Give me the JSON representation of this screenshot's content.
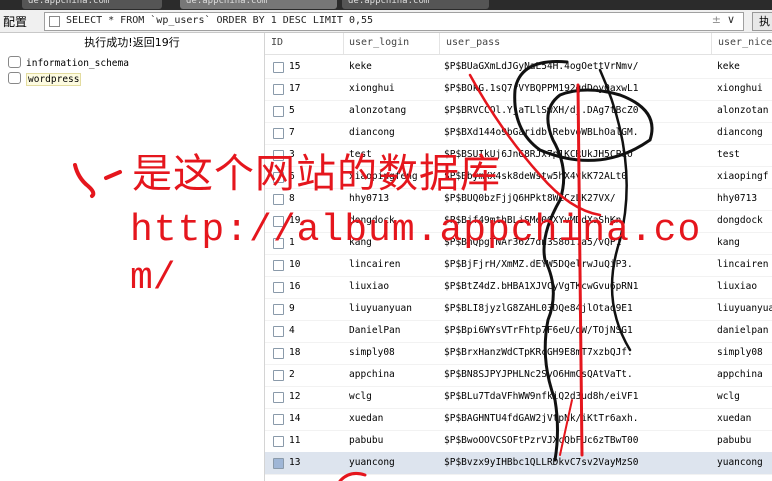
{
  "browser_tabs": [
    "de.appchina.com",
    "de.appchina.com",
    "de.appchina.com"
  ],
  "toolbar": {
    "config_label": "配置",
    "query": "SELECT * FROM `wp_users` ORDER BY 1 DESC LIMIT 0,55",
    "run_label": "执"
  },
  "left_panel": {
    "status": "执行成功!返回19行",
    "databases": [
      "information_schema",
      "wordpress"
    ]
  },
  "grid": {
    "columns": [
      "ID",
      "user_login",
      "user_pass",
      "user_nice"
    ],
    "rows": [
      {
        "id": "15",
        "login": "keke",
        "pass": "$P$BUaGXmLdJGyNaL54H.4ogOettVrNmv/",
        "nice": "keke"
      },
      {
        "id": "17",
        "login": "xionghui",
        "pass": "$P$BOkG.1sQ7rVYBQPPM192gdDoyOaxwL1",
        "nice": "xionghui"
      },
      {
        "id": "5",
        "login": "alonzotang",
        "pass": "$P$BRVCCQl.YjaTLlSwXH/dj.DAg7tBcZ0",
        "nice": "alonzotan"
      },
      {
        "id": "7",
        "login": "diancong",
        "pass": "$P$BXd144o9bGaridb.RebvoWBLhOalGM.",
        "nice": "diancong"
      },
      {
        "id": "3",
        "login": "test",
        "pass": "$P$BSUIkUj6JnG8RJx7p1KCRUkJH5CP1O",
        "nice": "test"
      },
      {
        "id": "6",
        "login": "xiaopingfeng",
        "pass": "$P$BbymXX4sk8deWstw5hX4vkK72ALt0",
        "nice": "xiaopingf"
      },
      {
        "id": "8",
        "login": "hhy0713",
        "pass": "$P$BUQ0bzFjjQ6HPkt8WECzLK27VX/",
        "nice": "hhy0713"
      },
      {
        "id": "19",
        "login": "dongdock",
        "pass": "$P$Bjf49mthBLiSMe0GXYvMDdXaShKn.",
        "nice": "dongdock"
      },
      {
        "id": "1",
        "login": "kang",
        "pass": "$P$BnQpgTNAr36Z7dn3S8oi.a5/vQP1",
        "nice": "kang"
      },
      {
        "id": "10",
        "login": "lincairen",
        "pass": "$P$BjFjrH/XmMZ.dEYW5DQelrwJuQiP3.",
        "nice": "lincairen"
      },
      {
        "id": "16",
        "login": "liuxiao",
        "pass": "$P$BtZ4dZ.bHBA1XJVCyVgTKcwGvu6pRN1",
        "nice": "liuxiao"
      },
      {
        "id": "9",
        "login": "liuyuanyuan",
        "pass": "$P$BLI8jyzlG8ZAHL03DQe84jlOtaq9E1",
        "nice": "liuyuanyuan"
      },
      {
        "id": "4",
        "login": "DanielPan",
        "pass": "$P$Bpi6WYsVTrFhtp7F6eU/qW/TOjNSG1",
        "nice": "danielpan"
      },
      {
        "id": "18",
        "login": "simply08",
        "pass": "$P$BrxHanzWdCTpKRcGH9E8mT7xzbQJf.",
        "nice": "simply08"
      },
      {
        "id": "2",
        "login": "appchina",
        "pass": "$P$BN8SJPYJPHLNc2SyO6HmCsQAtVaTt.",
        "nice": "appchina"
      },
      {
        "id": "12",
        "login": "wclg",
        "pass": "$P$BLu7TdaVFhWW9nfkiQ2d3ud8h/eiVF1",
        "nice": "wclg"
      },
      {
        "id": "14",
        "login": "xuedan",
        "pass": "$P$BAGHNTU4fdGAW2jVtpNk/iKtTr6axh.",
        "nice": "xuedan"
      },
      {
        "id": "11",
        "login": "pabubu",
        "pass": "$P$BwoOOVCSOFtPzrVJXcQbFUc6zTBwT00",
        "nice": "pabubu"
      },
      {
        "id": "13",
        "login": "yuancong",
        "pass": "$P$Bvzx9yIHBbc1QLLRDkvC7sv2VayMzS0",
        "nice": "yuancong"
      }
    ]
  },
  "annotation": {
    "line1": "是这个网站的数据库",
    "line2": "http://album.appchina.co",
    "line3": "m/",
    "color": "#e5161d"
  }
}
